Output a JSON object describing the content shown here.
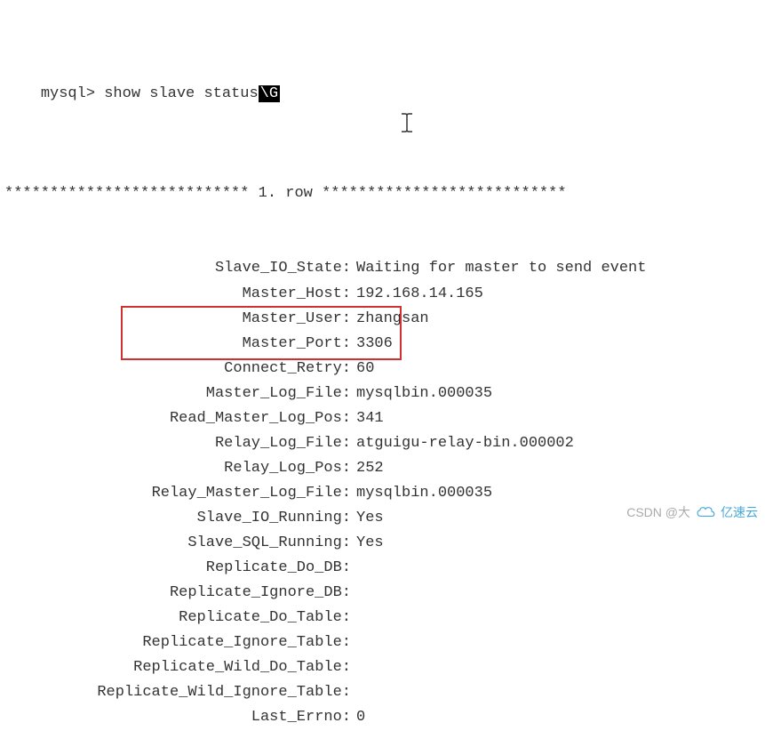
{
  "prompt": "mysql>",
  "command": "show slave status",
  "command_suffix": "\\G",
  "row_header": {
    "stars_left": "***************************",
    "row_text": " 1. row ",
    "stars_right": "***************************"
  },
  "status": [
    {
      "key": "Slave_IO_State:",
      "value": "Waiting for master to send event"
    },
    {
      "key": "Master_Host:",
      "value": "192.168.14.165"
    },
    {
      "key": "Master_User:",
      "value": "zhangsan"
    },
    {
      "key": "Master_Port:",
      "value": "3306"
    },
    {
      "key": "Connect_Retry:",
      "value": "60"
    },
    {
      "key": "Master_Log_File:",
      "value": "mysqlbin.000035"
    },
    {
      "key": "Read_Master_Log_Pos:",
      "value": "341"
    },
    {
      "key": "Relay_Log_File:",
      "value": "atguigu-relay-bin.000002"
    },
    {
      "key": "Relay_Log_Pos:",
      "value": "252"
    },
    {
      "key": "Relay_Master_Log_File:",
      "value": "mysqlbin.000035"
    },
    {
      "key": "Slave_IO_Running:",
      "value": "Yes"
    },
    {
      "key": "Slave_SQL_Running:",
      "value": "Yes"
    },
    {
      "key": "Replicate_Do_DB:",
      "value": ""
    },
    {
      "key": "Replicate_Ignore_DB:",
      "value": ""
    },
    {
      "key": "Replicate_Do_Table:",
      "value": ""
    },
    {
      "key": "Replicate_Ignore_Table:",
      "value": ""
    },
    {
      "key": "Replicate_Wild_Do_Table:",
      "value": ""
    },
    {
      "key": "Replicate_Wild_Ignore_Table:",
      "value": ""
    },
    {
      "key": "Last_Errno:",
      "value": "0"
    }
  ],
  "watermark": {
    "csdn": "CSDN @大",
    "yisu": "亿速云"
  }
}
